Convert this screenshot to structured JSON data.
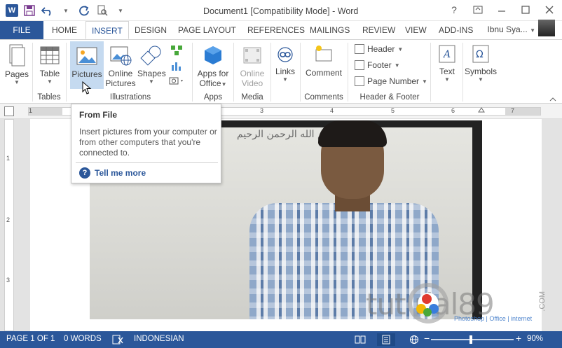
{
  "titlebar": {
    "app_icon": "W",
    "title": "Document1 [Compatibility Mode] - Word",
    "help": "?",
    "qat": [
      "save-icon",
      "undo-icon",
      "redo-icon",
      "print-preview-icon"
    ]
  },
  "tabs": [
    "FILE",
    "HOME",
    "INSERT",
    "DESIGN",
    "PAGE LAYOUT",
    "REFERENCES",
    "MAILINGS",
    "REVIEW",
    "VIEW",
    "ADD-INS"
  ],
  "user": {
    "name": "Ibnu Sya..."
  },
  "ribbon": {
    "pages": "Pages",
    "table": "Table",
    "tables_group": "Tables",
    "pictures": "Pictures",
    "online_pictures_1": "Online",
    "online_pictures_2": "Pictures",
    "shapes": "Shapes",
    "illustrations_group": "Illustrations",
    "apps_1": "Apps for",
    "apps_2": "Office",
    "apps_group": "Apps",
    "online_video_1": "Online",
    "online_video_2": "Video",
    "media_group": "Media",
    "links": "Links",
    "comment": "Comment",
    "comments_group": "Comments",
    "header": "Header",
    "footer": "Footer",
    "page_number": "Page Number",
    "hf_group": "Header & Footer",
    "text": "Text",
    "symbols": "Symbols"
  },
  "ruler": {
    "numbers": [
      "1",
      "1",
      "2",
      "3",
      "4",
      "5",
      "6",
      "7"
    ]
  },
  "vruler": {
    "numbers": [
      "1",
      "2",
      "3"
    ]
  },
  "document": {
    "arabic_text": "بسم الله الرحمن الرحيم"
  },
  "tooltip": {
    "title": "From File",
    "body": "Insert pictures from your computer or from other computers that you're connected to.",
    "link": "Tell me more"
  },
  "watermark": {
    "brand": "tut    rial89",
    "com": ".COM",
    "tagline": "Photoshop | Office | internet"
  },
  "status": {
    "page": "PAGE 1 OF 1",
    "words": "0 WORDS",
    "language": "INDONESIAN",
    "zoom": "90%",
    "zoom_value": 0.9
  },
  "colors": {
    "accent": "#2b579a",
    "hover": "#c5daf0"
  }
}
